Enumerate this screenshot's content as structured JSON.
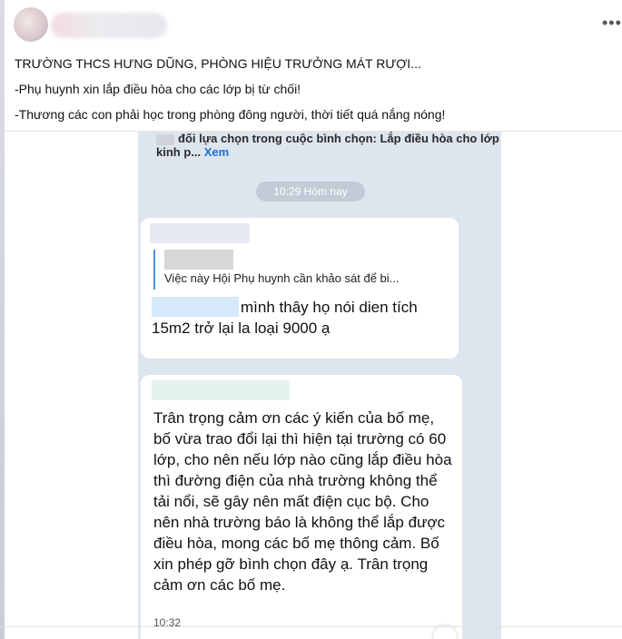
{
  "post": {
    "lines": [
      "TRƯỜNG THCS HƯNG DŨNG, PHÒNG HIỆU TRƯỞNG MÁT RƯỢI...",
      "-Phụ huynh xin lắp điều hòa cho các lớp bị từ chối!",
      "-Thương các con phải học trong phòng đông người, thời tiết quá nắng nóng!"
    ],
    "more_icon": "more-horizontal-icon"
  },
  "chat": {
    "poll_prefix": "đối lựa chọn trong cuộc bình chọn:",
    "poll_option": "Lắp điều hòa cho lớp kinh p...",
    "see_more": "Xem",
    "time_pill": "10:29 Hôm nay",
    "bubble1": {
      "quote_text": "Việc này Hội Phụ huynh cần khảo sát để bi...",
      "message": "mình thây họ nói dien tích 15m2 trở lại la loại  9000 ạ"
    },
    "bubble2": {
      "message": "Trân trọng cảm ơn các ý kiến của bố mẹ, bố vừa trao đổi lại thì hiện tại trường có 60 lớp, cho nên nếu lớp nào cũng lắp điều hòa thì đường điện của nhà trường không thể tải nổi, sẽ gây nên mất điện cục bộ. Cho nên nhà trường báo là không thể lắp được điều hòa, mong các bố mẹ thông cảm. Bố xin phép gỡ bình chọn đây ạ. Trân trọng cảm ơn các bố mẹ.",
      "time": "10:32"
    }
  }
}
